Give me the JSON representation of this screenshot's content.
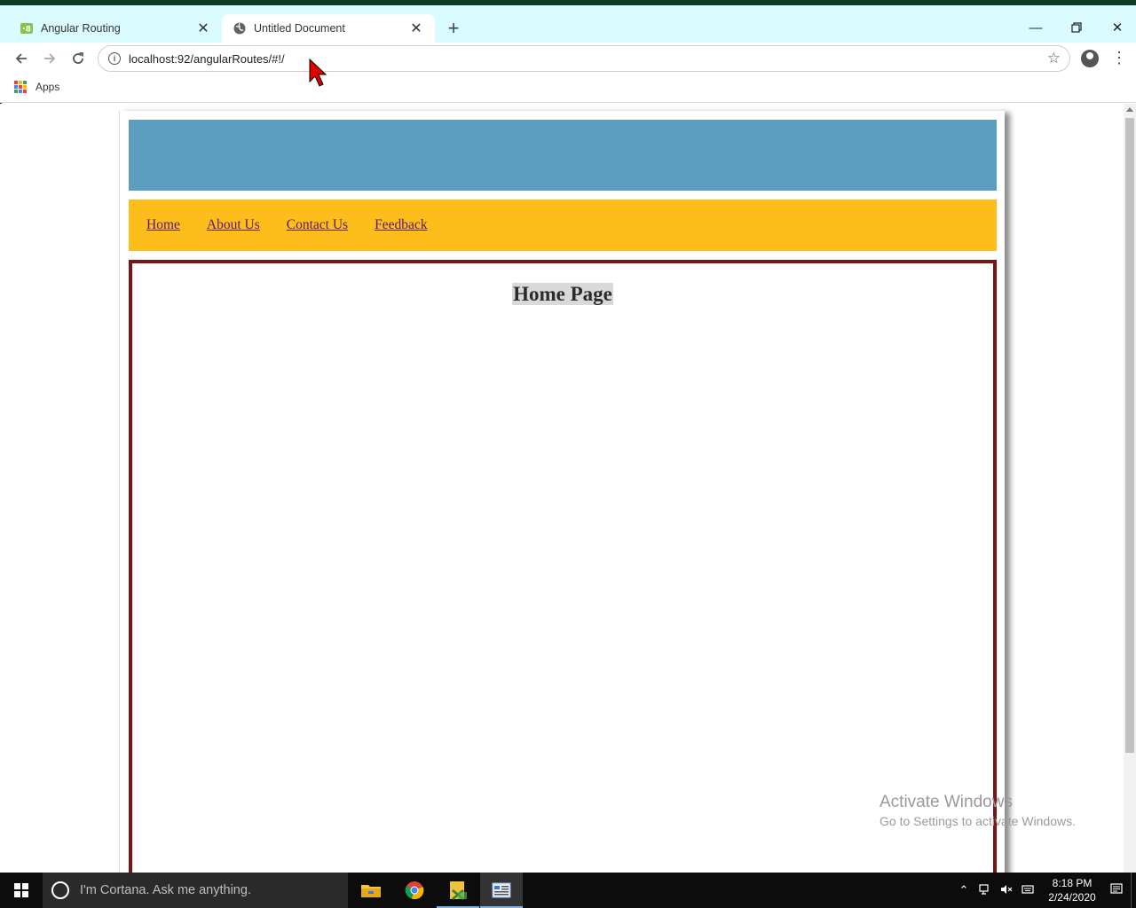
{
  "browser": {
    "tabs": [
      {
        "title": "Angular Routing",
        "active": false
      },
      {
        "title": "Untitled Document",
        "active": true
      }
    ],
    "url": "localhost:92/angularRoutes/#!/",
    "bookmarks": {
      "apps_label": "Apps"
    }
  },
  "page": {
    "nav_links": [
      "Home",
      "About Us",
      "Contact Us",
      "Feedback"
    ],
    "heading": "Home Page",
    "colors": {
      "banner": "#5b9ebf",
      "nav": "#fdbe1b",
      "content_border": "#7a1515",
      "link": "#5a1a6e"
    }
  },
  "watermark": {
    "line1": "Activate Windows",
    "line2": "Go to Settings to activate Windows."
  },
  "taskbar": {
    "search_placeholder": "I'm Cortana. Ask me anything.",
    "time": "8:18 PM",
    "date": "2/24/2020"
  }
}
